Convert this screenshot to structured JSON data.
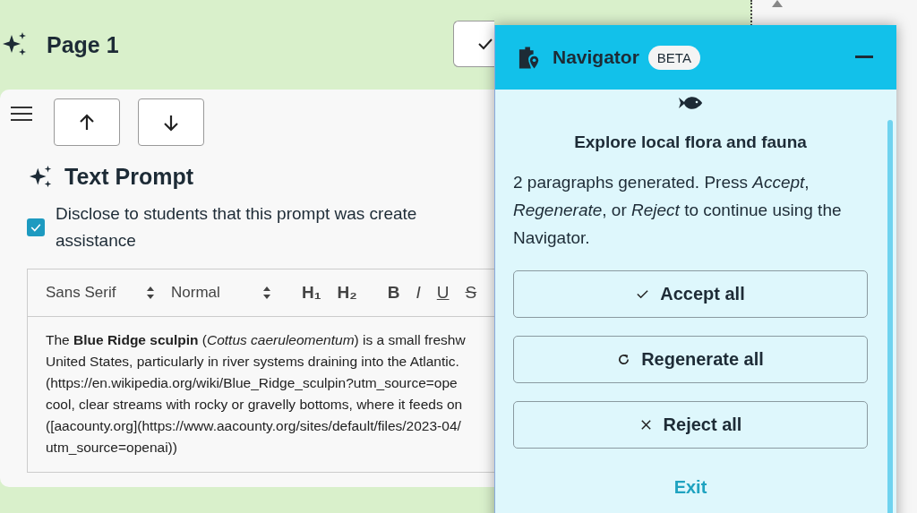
{
  "header": {
    "title": "Page 1"
  },
  "card": {
    "prompt_title": "Text Prompt",
    "disclose": {
      "lines": [
        "Disclose to students that this prompt was create",
        "assistance"
      ],
      "checked": true
    },
    "editor": {
      "font": "Sans Serif",
      "size": "Normal",
      "tools": [
        {
          "kind": "h1",
          "label": "H₁"
        },
        {
          "kind": "h2",
          "label": "H₂"
        },
        {
          "kind": "bold",
          "label": "B"
        },
        {
          "kind": "italic",
          "label": "I"
        },
        {
          "kind": "underline",
          "label": "U"
        },
        {
          "kind": "strike",
          "label": "S"
        }
      ],
      "lines": [
        "The **Blue Ridge sculpin** (*Cottus caeruleomentum*) is a small freshw",
        "United States, particularly in river systems draining into the Atlantic.",
        "(https://en.wikipedia.org/wiki/Blue_Ridge_sculpin?utm_source=ope",
        "cool, clear streams with rocky or gravelly bottoms, where it feeds on",
        "([aacounty.org](https://www.aacounty.org/sites/default/files/2023-04/",
        "utm_source=openai))"
      ]
    }
  },
  "navigator": {
    "title": "Navigator",
    "badge": "BETA",
    "heading": "Explore local flora and fauna",
    "message": "2 paragraphs generated. Press *Accept*, *Regenerate*, or *Reject* to continue using the Navigator.",
    "actions": [
      {
        "kind": "accept",
        "label": "Accept all"
      },
      {
        "kind": "regenerate",
        "label": "Regenerate all"
      },
      {
        "kind": "reject",
        "label": "Reject all"
      }
    ],
    "exit": "Exit"
  }
}
